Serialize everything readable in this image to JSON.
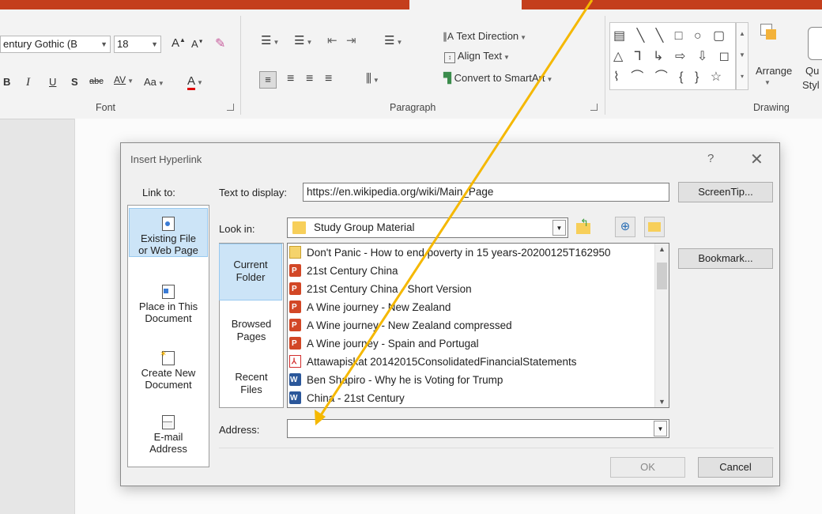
{
  "ribbon": {
    "font_name": "entury Gothic (B",
    "font_size": "18",
    "font_group_label": "Font",
    "paragraph_group_label": "Paragraph",
    "drawing_group_label": "Drawing",
    "text_direction_label": "Text Direction",
    "align_text_label": "Align Text",
    "convert_smartart_label": "Convert to SmartArt",
    "arrange_label": "Arrange",
    "quick_styles_label": "Qu",
    "quick_styles_label2": "Styl",
    "bold": "B",
    "italic": "I",
    "underline": "U",
    "shadow": "S",
    "strike": "abc",
    "spacing": "AV",
    "change_case": "Aa",
    "font_color": "A",
    "grow_font": "A",
    "shrink_font": "A"
  },
  "dialog": {
    "title": "Insert Hyperlink",
    "help": "?",
    "close": "✕",
    "link_to_label": "Link to:",
    "text_to_display_label": "Text to display:",
    "text_to_display_value": "https://en.wikipedia.org/wiki/Main_Page",
    "screentip_label": "ScreenTip...",
    "look_in_label": "Look in:",
    "look_in_value": "Study Group Material",
    "bookmark_label": "Bookmark...",
    "address_label": "Address:",
    "address_value": "",
    "ok_label": "OK",
    "cancel_label": "Cancel",
    "link_options": [
      {
        "line1": "Existing File",
        "line2": "or Web Page",
        "selected": true
      },
      {
        "line1": "Place in This",
        "line2": "Document",
        "selected": false
      },
      {
        "line1": "Create New",
        "line2": "Document",
        "selected": false
      },
      {
        "line1": "E-mail",
        "line2": "Address",
        "selected": false
      }
    ],
    "browse_options": [
      {
        "line1": "Current",
        "line2": "Folder",
        "selected": true
      },
      {
        "line1": "Browsed",
        "line2": "Pages",
        "selected": false
      },
      {
        "line1": "Recent",
        "line2": "Files",
        "selected": false
      }
    ],
    "files": [
      {
        "name": "Don't Panic - How to end poverty in 15 years-20200125T162950",
        "icon": "zip-icon"
      },
      {
        "name": "21st Century China",
        "icon": "powerpoint-file-icon"
      },
      {
        "name": "21st Century China - Short Version",
        "icon": "powerpoint-file-icon"
      },
      {
        "name": "A Wine journey - New Zealand",
        "icon": "powerpoint-file-icon"
      },
      {
        "name": "A Wine journey - New Zealand compressed",
        "icon": "powerpoint-file-icon"
      },
      {
        "name": "A Wine journey - Spain and Portugal",
        "icon": "powerpoint-file-icon"
      },
      {
        "name": "Attawapiskat 20142015ConsolidatedFinancialStatements",
        "icon": "pdf-file-icon"
      },
      {
        "name": "Ben Shapiro - Why he is Voting for Trump",
        "icon": "word-file-icon"
      },
      {
        "name": "China - 21st Century",
        "icon": "word-file-icon"
      }
    ]
  },
  "colors": {
    "ribbon_tab_bar": "#c43e1c",
    "annotation_arrow": "#f5b800",
    "selection": "#cce4f7"
  }
}
